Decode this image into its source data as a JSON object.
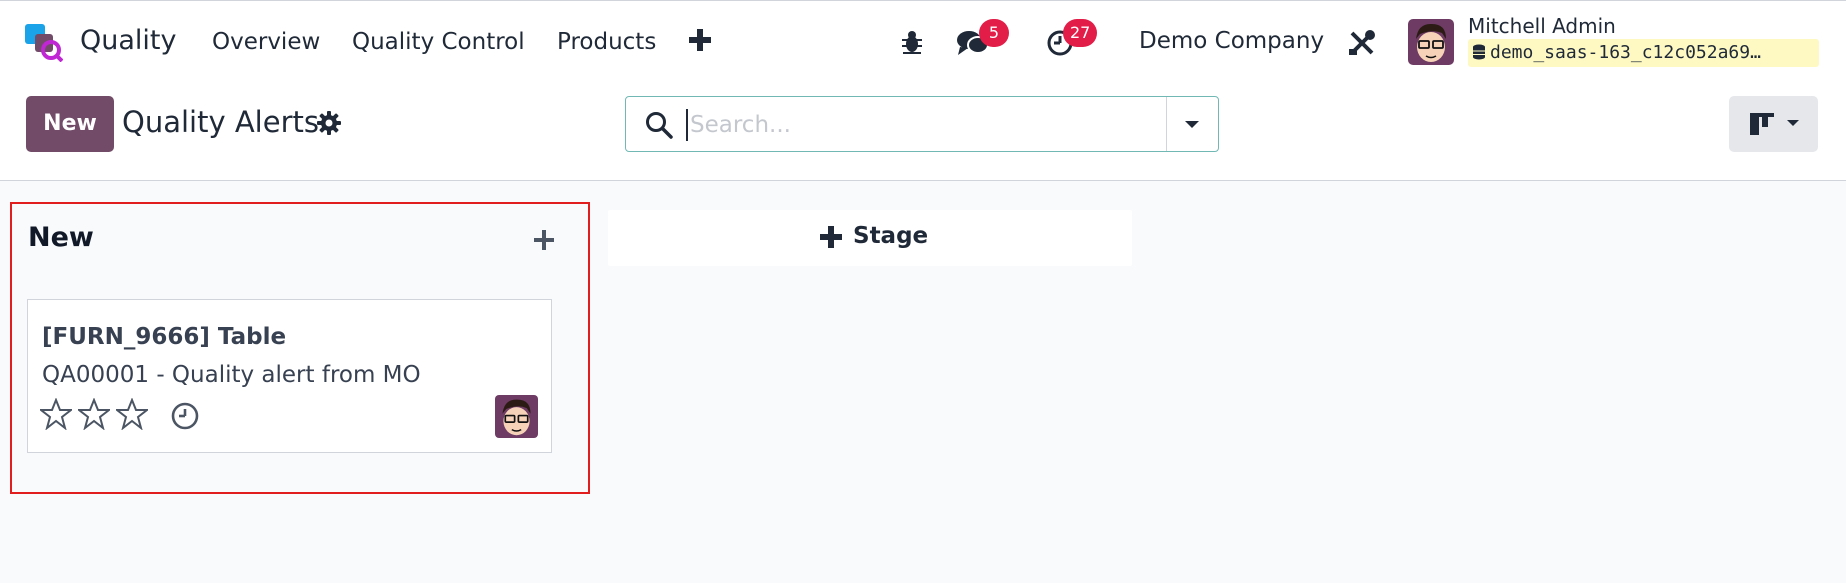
{
  "navbar": {
    "app_name": "Quality",
    "menu": [
      "Overview",
      "Quality Control",
      "Products"
    ],
    "icons": {
      "app_logo": "quality-app-logo",
      "new_menu": "plus-icon",
      "debug": "bug-icon",
      "messages": "chat-icon",
      "activities": "clock-icon",
      "settings": "tools-icon"
    },
    "messages_count": "5",
    "activities_count": "27",
    "company": "Demo Company",
    "user_name": "Mitchell Admin",
    "database": "demo_saas-163_c12c052a69…"
  },
  "control_panel": {
    "new_button": "New",
    "title": "Quality Alerts",
    "search_placeholder": "Search...",
    "view_mode": "kanban"
  },
  "kanban": {
    "columns": [
      {
        "title": "New",
        "cards": [
          {
            "title": "[FURN_9666] Table",
            "subtitle": "QA00001 - Quality alert from MO",
            "priority_stars": 0,
            "priority_max": 3
          }
        ]
      }
    ],
    "add_stage_label": "Stage"
  },
  "colors": {
    "brand": "#714b67",
    "badge": "#e11d48",
    "highlight_border": "#e11d1d",
    "db_pill": "#fef9c3"
  }
}
